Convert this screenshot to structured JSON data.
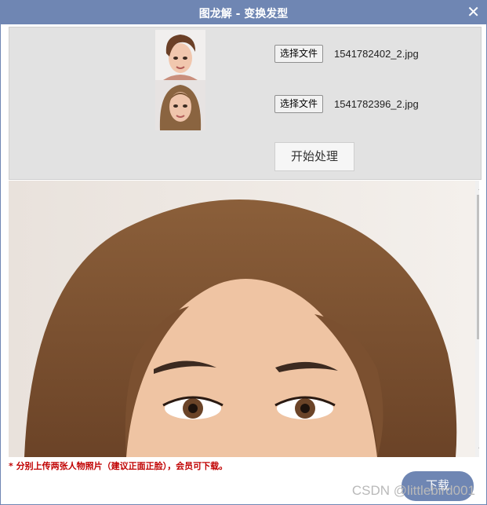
{
  "dialog": {
    "title": "图龙解 - 变换发型",
    "close_symbol": "✕"
  },
  "upload": {
    "file_button_label": "选择文件",
    "files": [
      {
        "name": "1541782402_2.jpg"
      },
      {
        "name": "1541782396_2.jpg"
      }
    ],
    "start_button_label": "开始处理"
  },
  "result": {
    "scroll_up_symbol": "▲",
    "scroll_down_symbol": "▼"
  },
  "footer": {
    "note": "* 分别上传两张人物照片（建议正面正脸），会员可下载。",
    "download_label": "下载",
    "watermark": "CSDN @littlebird001"
  },
  "colors": {
    "accent": "#6f86b3",
    "note_red": "#c00000"
  }
}
